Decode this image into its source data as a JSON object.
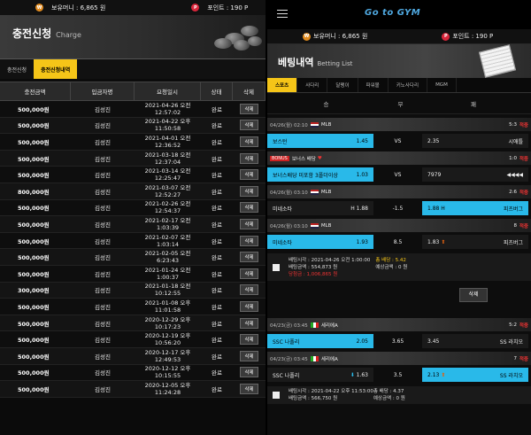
{
  "left": {
    "topbar": {
      "money_label": "보유머니 : 6,865 원",
      "point_label": "포인트 : 190 P"
    },
    "title": "충전신청",
    "subtitle": "Charge",
    "tabs": [
      "충전신청",
      "충전신청내역"
    ],
    "columns": [
      "충전금액",
      "입금자명",
      "요청일시",
      "상태",
      "삭제"
    ],
    "rows": [
      {
        "amount": "500,000원",
        "name": "김성진",
        "d1": "2021-04-26 오전",
        "d2": "12:57:02",
        "status": "완료"
      },
      {
        "amount": "500,000원",
        "name": "김성진",
        "d1": "2021-04-22 오후",
        "d2": "11:50:58",
        "status": "완료"
      },
      {
        "amount": "500,000원",
        "name": "김성진",
        "d1": "2021-04-01 오전",
        "d2": "12:36:52",
        "status": "완료"
      },
      {
        "amount": "500,000원",
        "name": "김성진",
        "d1": "2021-03-18 오전",
        "d2": "12:37:04",
        "status": "완료"
      },
      {
        "amount": "500,000원",
        "name": "김성진",
        "d1": "2021-03-14 오전",
        "d2": "12:25:47",
        "status": "완료"
      },
      {
        "amount": "800,000원",
        "name": "김성진",
        "d1": "2021-03-07 오전",
        "d2": "12:52:27",
        "status": "완료"
      },
      {
        "amount": "500,000원",
        "name": "김성진",
        "d1": "2021-02-26 오전",
        "d2": "12:54:37",
        "status": "완료"
      },
      {
        "amount": "500,000원",
        "name": "김성진",
        "d1": "2021-02-17 오전",
        "d2": "1:03:39",
        "status": "완료"
      },
      {
        "amount": "500,000원",
        "name": "김성진",
        "d1": "2021-02-07 오전",
        "d2": "1:03:14",
        "status": "완료"
      },
      {
        "amount": "500,000원",
        "name": "김성진",
        "d1": "2021-02-05 오전",
        "d2": "6:23:43",
        "status": "완료"
      },
      {
        "amount": "500,000원",
        "name": "김성진",
        "d1": "2021-01-24 오전",
        "d2": "1:00:37",
        "status": "완료"
      },
      {
        "amount": "300,000원",
        "name": "김성진",
        "d1": "2021-01-18 오전",
        "d2": "10:12:55",
        "status": "완료"
      },
      {
        "amount": "500,000원",
        "name": "김성진",
        "d1": "2021-01-08 오후",
        "d2": "11:01:58",
        "status": "완료"
      },
      {
        "amount": "500,000원",
        "name": "김성진",
        "d1": "2020-12-29 오후",
        "d2": "10:17:23",
        "status": "완료"
      },
      {
        "amount": "500,000원",
        "name": "김성진",
        "d1": "2020-12-19 오후",
        "d2": "10:56:20",
        "status": "완료"
      },
      {
        "amount": "500,000원",
        "name": "김성진",
        "d1": "2020-12-17 오후",
        "d2": "12:49:53",
        "status": "완료"
      },
      {
        "amount": "500,000원",
        "name": "김성진",
        "d1": "2020-12-12 오후",
        "d2": "10:15:55",
        "status": "완료"
      },
      {
        "amount": "500,000원",
        "name": "김성진",
        "d1": "2020-12-05 오후",
        "d2": "11:24:28",
        "status": "완료"
      }
    ],
    "delete_label": "삭제"
  },
  "right": {
    "logo": "Go to GYM",
    "topbar": {
      "money_label": "보유머니 : 6,865 원",
      "point_label": "포인트 : 190 P"
    },
    "title": "베팅내역",
    "subtitle": "Betting List",
    "tabs": [
      "스포츠",
      "사다리",
      "달팽이",
      "파워볼",
      "키노사다리",
      "MGM"
    ],
    "columns": [
      "승",
      "무",
      "패"
    ],
    "g1": {
      "date": "04/26(월) 02:10",
      "league": "MLB",
      "score": "5:3",
      "hit": "적중"
    },
    "b1": {
      "home": "보스턴",
      "hodd": "1.45",
      "mid": "VS",
      "aodd": "2.35",
      "away": "시애틀"
    },
    "g2": {
      "league": "보너스 배당",
      "score": "1:0",
      "hit": "적중"
    },
    "b2": {
      "home": "보너스배당 미포함 3폴더이상",
      "hodd": "1.03",
      "mid": "VS",
      "aodd": "7979",
      "away": "◀◀◀◀"
    },
    "g3": {
      "date": "04/26(월) 03:10",
      "league": "MLB",
      "score": "2:6",
      "hit": "적중"
    },
    "b3": {
      "home": "미네소타",
      "hodd": "H 1.88",
      "mid": "-1.5",
      "aodd": "1.88 H",
      "away": "피츠버그"
    },
    "g4": {
      "date": "04/26(월) 03:10",
      "league": "MLB",
      "score": "8",
      "hit": "적중"
    },
    "b4": {
      "home": "미네소타",
      "hodd": "1.93",
      "mid": "8.5",
      "aodd": "1.83",
      "away": "피츠버그"
    },
    "d1": {
      "t1": "배팅시각 : 2021-04-26 오전 1:00:00",
      "t2": "배팅금액 : 554,873 원",
      "t3": "당첨금 : 1,006,865 원",
      "c1": "총 배당 : 5.42",
      "c2": "예상금액 : 0 원"
    },
    "delete_label": "삭제",
    "g5": {
      "date": "04/23(금) 03:45",
      "league": "세리에A",
      "score": "5:2",
      "hit": "적중"
    },
    "b5": {
      "home": "SSC 나폴리",
      "hodd": "2.05",
      "mid": "3.65",
      "aodd": "3.45",
      "away": "SS 라치오"
    },
    "g6": {
      "date": "04/23(금) 03:45",
      "league": "세리에A",
      "score": "7",
      "hit": "적중"
    },
    "b6": {
      "home": "SSC 나폴리",
      "hodd": "1.63",
      "mid": "3.5",
      "aodd": "2.13",
      "away": "SS 라치오"
    },
    "d2": {
      "t1": "배팅시각 : 2021-04-22 오후 11:53:00",
      "t2": "배팅금액 : 566,750 원",
      "c1": "총 배당 : 4.37",
      "c2": "예상금액 : 0 원"
    }
  }
}
